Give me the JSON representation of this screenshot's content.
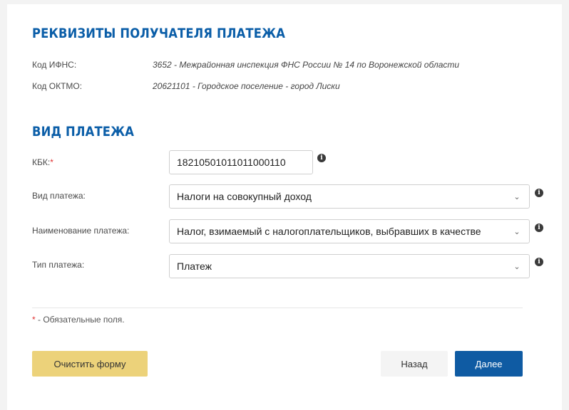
{
  "recipient": {
    "title": "РЕКВИЗИТЫ ПОЛУЧАТЕЛЯ ПЛАТЕЖА",
    "ifns_label": "Код ИФНС:",
    "ifns_value": "3652 - Межрайонная инспекция ФНС России № 14 по Воронежской области",
    "oktmo_label": "Код ОКТМО:",
    "oktmo_value": "20621101 - Городское поселение - город Лиски"
  },
  "payment": {
    "title": "ВИД ПЛАТЕЖА",
    "kbk_label": "КБК:",
    "kbk_required_mark": "*",
    "kbk_value": "18210501011011000110",
    "type_label": "Вид платежа:",
    "type_value": "Налоги на совокупный доход",
    "name_label": "Наименование платежа:",
    "name_value": "Налог, взимаемый с налогоплательщиков, выбравших в качестве",
    "kind_label": "Тип платежа:",
    "kind_value": "Платеж"
  },
  "required_note": {
    "mark": "*",
    "text": " - Обязательные поля."
  },
  "buttons": {
    "clear": "Очистить форму",
    "back": "Назад",
    "next": "Далее"
  },
  "icons": {
    "info": "info-icon",
    "chevron": "chevron-down-icon"
  },
  "colors": {
    "title": "#0b5ea8",
    "required": "#e03030",
    "clear_button": "#ecd27a",
    "next_button": "#0f5ba3"
  }
}
